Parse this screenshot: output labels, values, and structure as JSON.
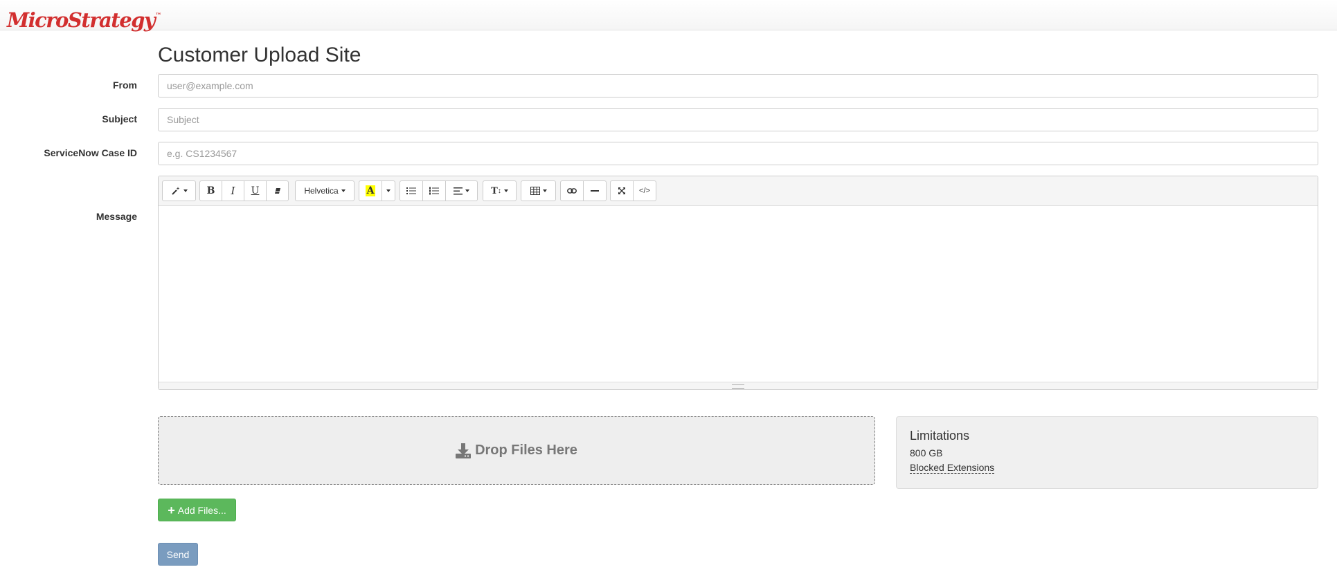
{
  "header": {
    "brand": "MicroStrategy",
    "brand_mark": "™"
  },
  "page": {
    "title": "Customer Upload Site"
  },
  "form": {
    "from": {
      "label": "From",
      "value": "",
      "placeholder": "user@example.com"
    },
    "subject": {
      "label": "Subject",
      "value": "",
      "placeholder": "Subject"
    },
    "case_id": {
      "label": "ServiceNow Case ID",
      "value": "",
      "placeholder": "e.g. CS1234567"
    },
    "message": {
      "label": "Message",
      "value": ""
    }
  },
  "editor_toolbar": {
    "style_icon": "magic-wand-icon",
    "bold_label": "B",
    "italic_label": "I",
    "underline_label": "U",
    "eraser_icon": "eraser-icon",
    "font_name": "Helvetica",
    "color_label": "A",
    "highlight_color": "#ffff00",
    "unordered_list_icon": "unordered-list-icon",
    "ordered_list_icon": "ordered-list-icon",
    "align_icon": "align-left-icon",
    "line_height_label": "T",
    "table_icon": "table-icon",
    "link_icon": "link-icon",
    "hr_icon": "horizontal-rule-icon",
    "fullscreen_icon": "fullscreen-icon",
    "code_label": "</>"
  },
  "dropzone": {
    "label": "Drop Files Here",
    "icon": "download-icon"
  },
  "limitations": {
    "title": "Limitations",
    "size": "800 GB",
    "blocked_link": "Blocked Extensions"
  },
  "buttons": {
    "add_files": "Add Files...",
    "add_icon": "plus-icon",
    "send": "Send"
  },
  "colors": {
    "brand": "#d22f2f",
    "success": "#5cb85c",
    "primary": "#7a9cbf"
  }
}
